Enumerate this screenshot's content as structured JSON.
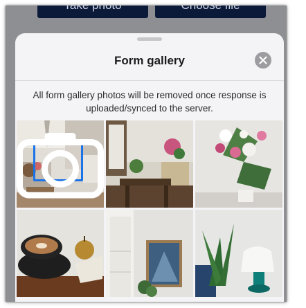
{
  "background": {
    "take_photo_label": "Take photo",
    "choose_file_label": "Choose file"
  },
  "sheet": {
    "title": "Form gallery",
    "close_icon": "close-x-circle-icon",
    "notice": "All form gallery photos will be removed once response is uploaded/synced to the server."
  },
  "gallery": {
    "photos": [
      {
        "subject": "cafe-table-with-camera-overlay",
        "selected": true,
        "overlay_icon": "camera-icon"
      },
      {
        "subject": "window-bench-with-flowers",
        "selected": false
      },
      {
        "subject": "lily-bouquet",
        "selected": false
      },
      {
        "subject": "latte-cup-and-pear",
        "selected": false
      },
      {
        "subject": "window-and-framed-art",
        "selected": false
      },
      {
        "subject": "plant-and-lamp",
        "selected": false
      }
    ]
  },
  "colors": {
    "selection_accent": "#1a73e8",
    "sheet_background": "#f4f4f6"
  }
}
